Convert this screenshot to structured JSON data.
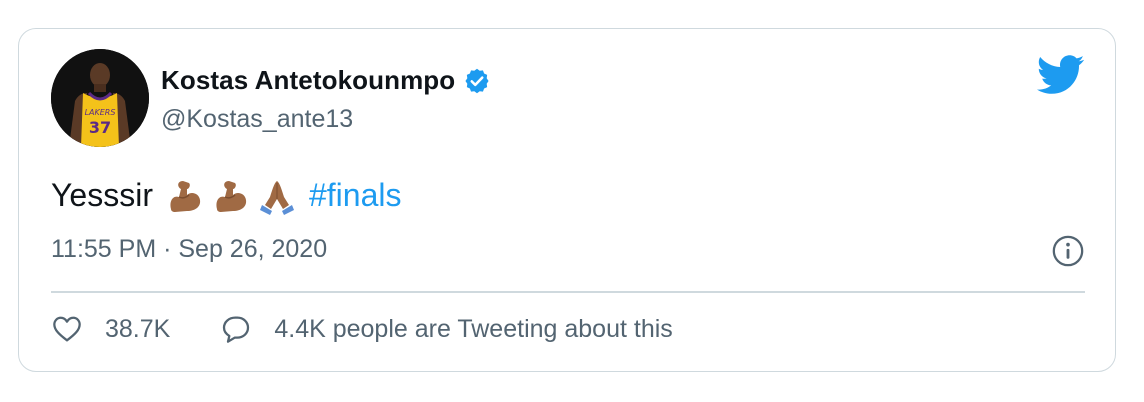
{
  "tweet": {
    "author_name": "Kostas Antetokounmpo",
    "author_handle": "@Kostas_ante13",
    "verified_icon": "verified-badge-icon",
    "platform_icon": "twitter-bird-icon",
    "text_prefix": "Yesssir",
    "emojis": [
      "flexed-biceps-emoji",
      "flexed-biceps-emoji",
      "folded-hands-emoji"
    ],
    "hashtag": "#finals",
    "timestamp": "11:55 PM · Sep 26, 2020",
    "likes_count": "38.7K",
    "replies_text": "4.4K people are Tweeting about this",
    "avatar_jersey_number": "37",
    "avatar_jersey_text": "LAKERS"
  },
  "colors": {
    "accent": "#1d9bf0",
    "text_primary": "#0f1419",
    "text_secondary": "#536471",
    "border": "#cfd9de"
  }
}
